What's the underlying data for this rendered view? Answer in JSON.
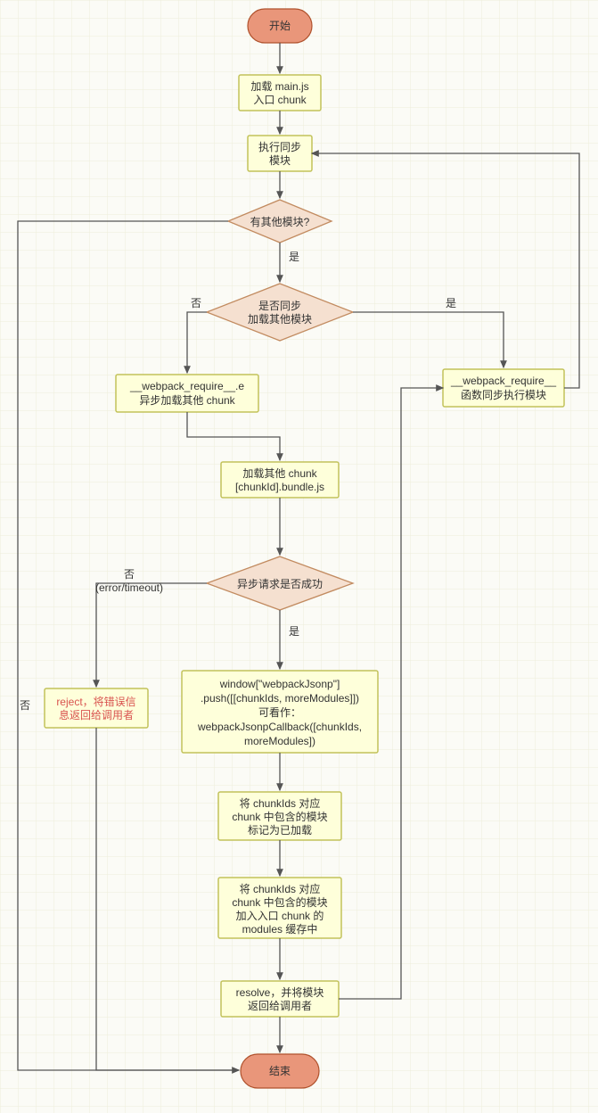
{
  "terminal": {
    "start": "开始",
    "end": "结束"
  },
  "process": {
    "loadMain1": "加载 main.js",
    "loadMain2": "入口 chunk",
    "execSync1": "执行同步",
    "execSync2": "模块",
    "asyncReq1": "__webpack_require__.e",
    "asyncReq2": "异步加载其他  chunk",
    "syncReq1": "__webpack_require__",
    "syncReq2": "函数同步执行模块",
    "loadChunk1": "加载其他 chunk",
    "loadChunk2": "[chunkId].bundle.js",
    "reject1": "reject，将错误信",
    "reject2": "息返回给调用者",
    "jsonp1": "window[\"webpackJsonp\"]",
    "jsonp2": ".push([[chunkIds, moreModules]])",
    "jsonp3": "可看作：",
    "jsonp4": "webpackJsonpCallback([chunkIds,",
    "jsonp5": "moreModules])",
    "mark1": "将 chunkIds 对应",
    "mark2": "chunk 中包含的模块",
    "mark3": "标记为已加载",
    "cache1": "将 chunkIds 对应",
    "cache2": "chunk 中包含的模块",
    "cache3": "加入入口 chunk 的",
    "cache4": "modules 缓存中",
    "resolve1": "resolve，并将模块",
    "resolve2": "返回给调用者"
  },
  "decision": {
    "hasOther": "有其他模块?",
    "isSync1": "是否同步",
    "isSync2": "加载其他模块",
    "asyncOk": "异步请求是否成功"
  },
  "labels": {
    "yes": "是",
    "no": "否",
    "noErr1": "否",
    "noErr2": "(error/timeout)"
  }
}
